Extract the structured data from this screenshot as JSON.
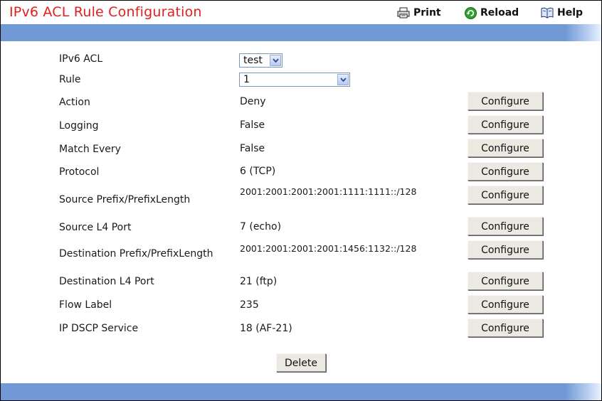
{
  "header": {
    "title": "IPv6 ACL Rule Configuration",
    "print_label": "Print",
    "reload_label": "Reload",
    "help_label": "Help"
  },
  "colors": {
    "title": "#e02020",
    "band": "#7099d6",
    "button_face": "#ece9e2"
  },
  "form": {
    "acl": {
      "label": "IPv6 ACL",
      "selected": "test"
    },
    "rule": {
      "label": "Rule",
      "selected": "1"
    },
    "rows": [
      {
        "label": "Action",
        "value": "Deny",
        "button": "Configure"
      },
      {
        "label": "Logging",
        "value": "False",
        "button": "Configure"
      },
      {
        "label": "Match Every",
        "value": "False",
        "button": "Configure"
      },
      {
        "label": "Protocol",
        "value": "6 (TCP)",
        "button": "Configure"
      },
      {
        "label": "Source Prefix/PrefixLength",
        "value": "2001:2001:2001:2001:1111:1111::/128",
        "button": "Configure"
      },
      {
        "label": "Source L4 Port",
        "value": "7 (echo)",
        "button": "Configure"
      },
      {
        "label": "Destination Prefix/PrefixLength",
        "value": "2001:2001:2001:2001:1456:1132::/128",
        "button": "Configure"
      },
      {
        "label": "Destination L4 Port",
        "value": "21 (ftp)",
        "button": "Configure"
      },
      {
        "label": "Flow Label",
        "value": "235",
        "button": "Configure"
      },
      {
        "label": "IP DSCP Service",
        "value": "18 (AF-21)",
        "button": "Configure"
      }
    ],
    "delete_label": "Delete"
  }
}
